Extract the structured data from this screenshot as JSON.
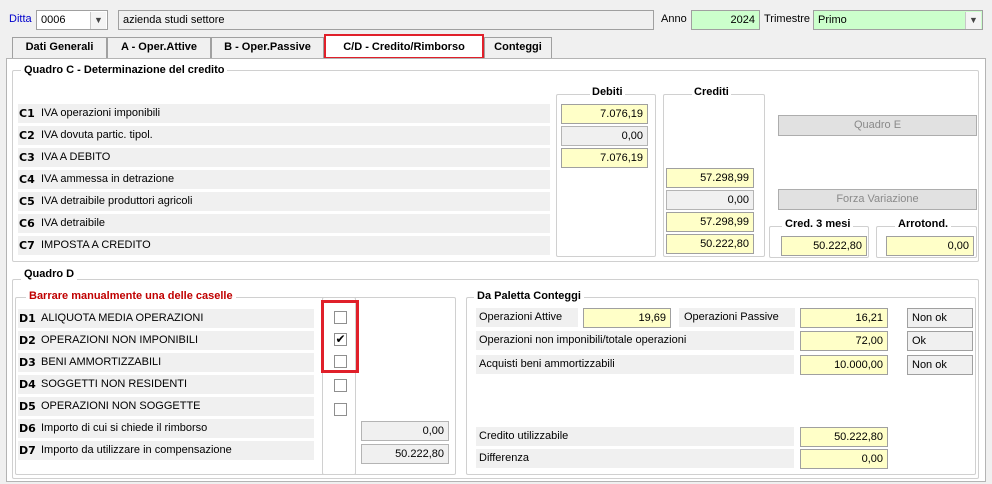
{
  "header": {
    "ditta_label": "Ditta",
    "ditta_value": "0006",
    "ditta_name": "azienda studi settore",
    "anno_label": "Anno",
    "anno_value": "2024",
    "trimestre_label": "Trimestre",
    "trimestre_value": "Primo"
  },
  "tabs": [
    {
      "label": "Dati Generali"
    },
    {
      "label": "A - Oper.Attive"
    },
    {
      "label": "B - Oper.Passive"
    },
    {
      "label": "C/D - Credito/Rimborso"
    },
    {
      "label": "Conteggi"
    }
  ],
  "quadro_c": {
    "title": "Quadro C - Determinazione del credito",
    "debiti_header": "Debiti",
    "crediti_header": "Crediti",
    "rows": [
      {
        "code": "C1",
        "label": "IVA operazioni imponibili",
        "debiti": "7.076,19",
        "crediti": ""
      },
      {
        "code": "C2",
        "label": "IVA dovuta partic. tipol.",
        "debiti": "0,00",
        "crediti": ""
      },
      {
        "code": "C3",
        "label": "IVA A DEBITO",
        "debiti": "7.076,19",
        "crediti": ""
      },
      {
        "code": "C4",
        "label": "IVA ammessa in detrazione",
        "debiti": "",
        "crediti": "57.298,99"
      },
      {
        "code": "C5",
        "label": "IVA detraibile produttori agricoli",
        "debiti": "",
        "crediti": "0,00"
      },
      {
        "code": "C6",
        "label": "IVA detraibile",
        "debiti": "",
        "crediti": "57.298,99"
      },
      {
        "code": "C7",
        "label": "IMPOSTA A CREDITO",
        "debiti": "",
        "crediti": "50.222,80"
      }
    ],
    "quadro_e_button": "Quadro E",
    "forza_variazione_button": "Forza Variazione",
    "cred3mesi_label": "Cred. 3 mesi",
    "cred3mesi_value": "50.222,80",
    "arrotond_label": "Arrotond.",
    "arrotond_value": "0,00"
  },
  "quadro_d": {
    "title": "Quadro D",
    "instruction": "Barrare manualmente una delle caselle",
    "rows": [
      {
        "code": "D1",
        "label": "ALIQUOTA MEDIA OPERAZIONI",
        "checked": false
      },
      {
        "code": "D2",
        "label": "OPERAZIONI NON IMPONIBILI",
        "checked": true
      },
      {
        "code": "D3",
        "label": "BENI AMMORTIZZABILI",
        "checked": false
      },
      {
        "code": "D4",
        "label": "SOGGETTI NON RESIDENTI",
        "checked": false
      },
      {
        "code": "D5",
        "label": "OPERAZIONI NON SOGGETTE",
        "checked": false
      }
    ],
    "d6_code": "D6",
    "d6_label": "Importo di cui si chiede il rimborso",
    "d6_value": "0,00",
    "d7_code": "D7",
    "d7_label": "Importo da utilizzare in compensazione",
    "d7_value": "50.222,80"
  },
  "paletta": {
    "title": "Da Paletta Conteggi",
    "oper_attive_label": "Operazioni Attive",
    "oper_attive_value": "19,69",
    "oper_passive_label": "Operazioni Passive",
    "oper_passive_value": "16,21",
    "oper_passive_status": "Non ok",
    "non_imponibili_label": "Operazioni non imponibili/totale operazioni",
    "non_imponibili_value": "72,00",
    "non_imponibili_status": "Ok",
    "beni_label": "Acquisti beni ammortizzabili",
    "beni_value": "10.000,00",
    "beni_status": "Non ok",
    "credito_label": "Credito utilizzabile",
    "credito_value": "50.222,80",
    "differenza_label": "Differenza",
    "differenza_value": "0,00"
  },
  "colors": {
    "highlight_red": "#e0202a",
    "instruction_red": "#c00000",
    "input_yellow": "#ffffc8",
    "input_green": "#ccffcc",
    "label_blue": "#0000cc"
  }
}
